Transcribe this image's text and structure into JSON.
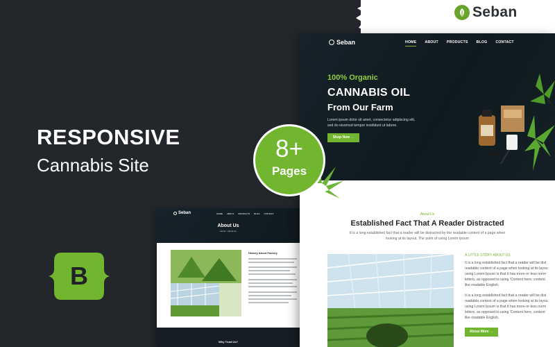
{
  "brand": {
    "name": "Seban"
  },
  "headline": {
    "line1": "RESPONSIVE",
    "line2": "Cannabis Site"
  },
  "badge": {
    "number": "8+",
    "label": "Pages"
  },
  "bootstrap": {
    "letter": "B"
  },
  "main_preview": {
    "logo": "Seban",
    "nav": [
      "HOME",
      "ABOUT",
      "PRODUCTS",
      "BLOG",
      "CONTACT"
    ],
    "hero": {
      "tagline": "100% Organic",
      "title": "CANNABIS OIL",
      "subtitle": "From Our Farm",
      "desc_line1": "Lorem ipsum dolor sit amet, consectetur adipiscing elit,",
      "desc_line2": "sed do eiusmod tempor incididunt ut labore.",
      "button": "Shop Now →"
    },
    "about": {
      "tag": "About Us",
      "title": "Established Fact That A Reader Distracted",
      "desc_line1": "It is a long established fact that a reader will be distracted by the readable content of a page when",
      "desc_line2": "looking at its layout. The point of using Lorem Ipsum",
      "story_heading": "A LITTLE STORY ABOUT US",
      "para1": [
        "It is a long established fact that a reader will be dist",
        "readable content of a page when looking at its layou",
        "using Lorem Ipsum is that it has more-or-less norm",
        "letters, as opposed to using 'Content here, content",
        "like readable English."
      ],
      "para2": [
        "It is a long established fact that a reader will be dist",
        "readable content of a page when looking at its layou",
        "using Lorem Ipsum is that it has more-or-less norm",
        "letters, as opposed to using 'Content here, content",
        "like readable English."
      ],
      "button": "About More →"
    }
  },
  "second_preview": {
    "logo": "Seban",
    "nav": [
      "HOME",
      "ABOUT",
      "PRODUCTS",
      "BLOG",
      "CONTACT"
    ],
    "title": "About Us",
    "breadcrumb": "Home  >  About Us",
    "heading": "History About Factory",
    "footer_title": "Why Trust Us?"
  },
  "colors": {
    "accent": "#72b52f",
    "dark": "#23272b",
    "hero": "#16232a"
  }
}
